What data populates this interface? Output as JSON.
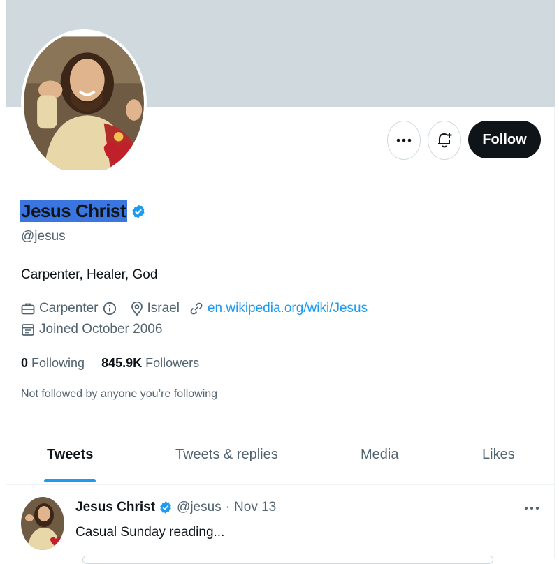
{
  "profile": {
    "name": "Jesus Christ",
    "handle": "@jesus",
    "bio": "Carpenter, Healer, God",
    "occupation": "Carpenter",
    "location": "Israel",
    "website": "en.wikipedia.org/wiki/Jesus",
    "joined": "Joined October 2006",
    "following_count": "0",
    "following_label": "Following",
    "followers_count": "845.9K",
    "followers_label": "Followers",
    "not_followed_note": "Not followed by anyone you’re following",
    "verified": true
  },
  "actions": {
    "follow_label": "Follow",
    "more_icon": "more-dots-icon",
    "notify_icon": "bell-plus-icon"
  },
  "tabs": [
    {
      "label": "Tweets",
      "active": true
    },
    {
      "label": "Tweets & replies",
      "active": false
    },
    {
      "label": "Media",
      "active": false
    },
    {
      "label": "Likes",
      "active": false
    }
  ],
  "tweet": {
    "author": "Jesus Christ",
    "handle": "@jesus",
    "separator": "·",
    "date": "Nov 13",
    "text": "Casual Sunday reading..."
  },
  "colors": {
    "accent": "#1d9bf0",
    "banner": "#cfd9de",
    "selection": "#3b76e0",
    "text": "#0f1419",
    "muted": "#536471"
  }
}
